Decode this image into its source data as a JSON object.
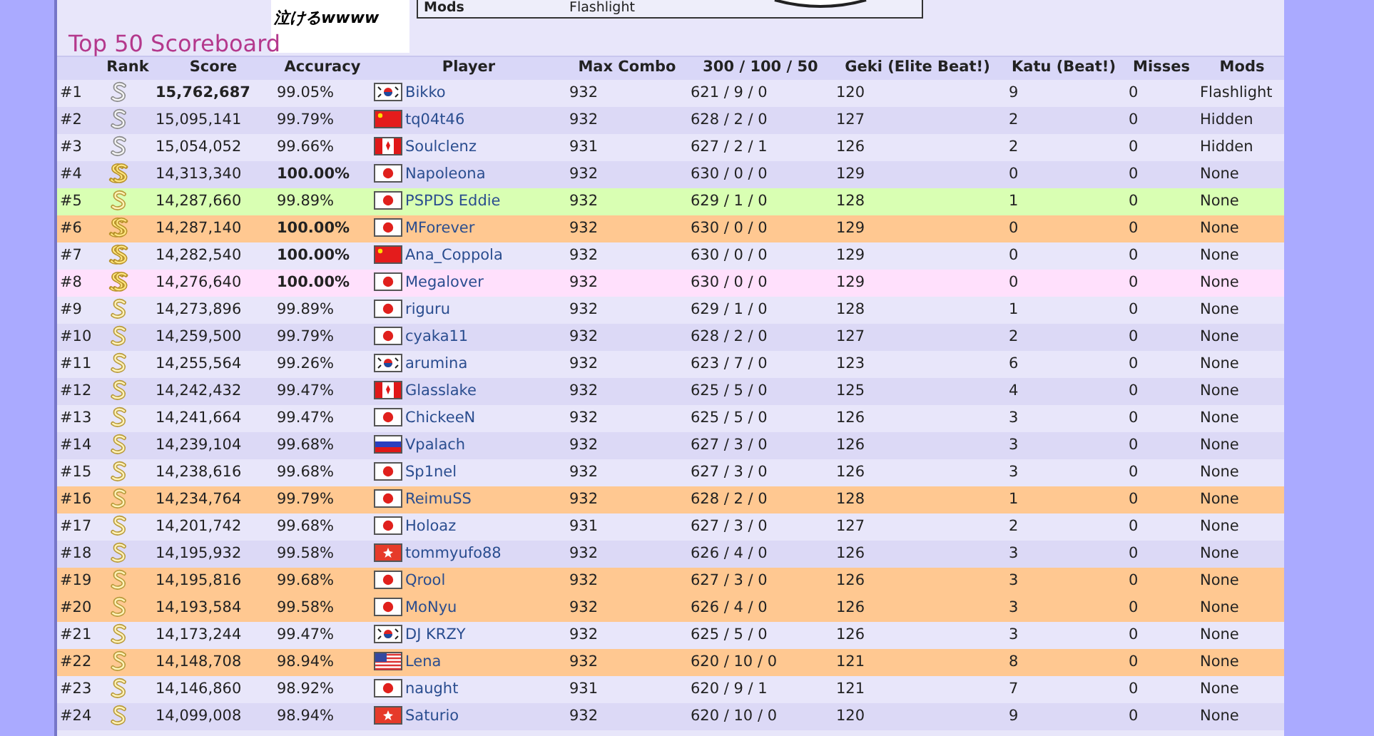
{
  "mods_box": {
    "label": "Mods",
    "value": "Flashlight"
  },
  "banner": {
    "text": "泣けるwwww"
  },
  "title": "Top 50 Scoreboard",
  "columns": [
    "Rank",
    "Score",
    "Accuracy",
    "Player",
    "Max Combo",
    "300 / 100 / 50",
    "Geki (Elite Beat!)",
    "Katu (Beat!)",
    "Misses",
    "Mods"
  ],
  "rows": [
    {
      "position": "#1",
      "grade": {
        "kind": "s_silver"
      },
      "score": "15,762,687",
      "score_bold": true,
      "accuracy": "99.05%",
      "accuracy_bold": false,
      "flag": {
        "kind": "kr"
      },
      "player": "Bikko",
      "max_combo": "932",
      "hits": "621 / 9 / 0",
      "geki": "120",
      "katu": "9",
      "misses": "0",
      "mods": "Flashlight"
    },
    {
      "position": "#2",
      "grade": {
        "kind": "s_silver"
      },
      "score": "15,095,141",
      "score_bold": false,
      "accuracy": "99.79%",
      "accuracy_bold": false,
      "flag": {
        "kind": "cn"
      },
      "player": "tq04t46",
      "max_combo": "932",
      "hits": "628 / 2 / 0",
      "geki": "127",
      "katu": "2",
      "misses": "0",
      "mods": "Hidden"
    },
    {
      "position": "#3",
      "grade": {
        "kind": "s_silver"
      },
      "score": "15,054,052",
      "score_bold": false,
      "accuracy": "99.66%",
      "accuracy_bold": false,
      "flag": {
        "kind": "ca"
      },
      "player": "Soulclenz",
      "max_combo": "931",
      "hits": "627 / 2 / 1",
      "geki": "126",
      "katu": "2",
      "misses": "0",
      "mods": "Hidden"
    },
    {
      "position": "#4",
      "grade": {
        "kind": "ss_gold"
      },
      "score": "14,313,340",
      "score_bold": false,
      "accuracy": "100.00%",
      "accuracy_bold": true,
      "flag": {
        "kind": "jp"
      },
      "player": "Napoleona",
      "max_combo": "932",
      "hits": "630 / 0 / 0",
      "geki": "129",
      "katu": "0",
      "misses": "0",
      "mods": "None"
    },
    {
      "position": "#5",
      "grade": {
        "kind": "s_gold"
      },
      "score": "14,287,660",
      "score_bold": false,
      "accuracy": "99.89%",
      "accuracy_bold": false,
      "flag": {
        "kind": "jp"
      },
      "player": "PSPDS Eddie",
      "max_combo": "932",
      "hits": "629 / 1 / 0",
      "geki": "128",
      "katu": "1",
      "misses": "0",
      "mods": "None",
      "color": "#d9ffb3"
    },
    {
      "position": "#6",
      "grade": {
        "kind": "ss_gold"
      },
      "score": "14,287,140",
      "score_bold": false,
      "accuracy": "100.00%",
      "accuracy_bold": true,
      "flag": {
        "kind": "jp"
      },
      "player": "MForever",
      "max_combo": "932",
      "hits": "630 / 0 / 0",
      "geki": "129",
      "katu": "0",
      "misses": "0",
      "mods": "None",
      "color": "#ffc891"
    },
    {
      "position": "#7",
      "grade": {
        "kind": "ss_gold"
      },
      "score": "14,282,540",
      "score_bold": false,
      "accuracy": "100.00%",
      "accuracy_bold": true,
      "flag": {
        "kind": "cn"
      },
      "player": "Ana_Coppola",
      "max_combo": "932",
      "hits": "630 / 0 / 0",
      "geki": "129",
      "katu": "0",
      "misses": "0",
      "mods": "None"
    },
    {
      "position": "#8",
      "grade": {
        "kind": "ss_gold"
      },
      "score": "14,276,640",
      "score_bold": false,
      "accuracy": "100.00%",
      "accuracy_bold": true,
      "flag": {
        "kind": "jp"
      },
      "player": "Megalover",
      "max_combo": "932",
      "hits": "630 / 0 / 0",
      "geki": "129",
      "katu": "0",
      "misses": "0",
      "mods": "None",
      "color": "#ffe0fc"
    },
    {
      "position": "#9",
      "grade": {
        "kind": "s_gold"
      },
      "score": "14,273,896",
      "score_bold": false,
      "accuracy": "99.89%",
      "accuracy_bold": false,
      "flag": {
        "kind": "jp"
      },
      "player": "riguru",
      "max_combo": "932",
      "hits": "629 / 1 / 0",
      "geki": "128",
      "katu": "1",
      "misses": "0",
      "mods": "None"
    },
    {
      "position": "#10",
      "grade": {
        "kind": "s_gold"
      },
      "score": "14,259,500",
      "score_bold": false,
      "accuracy": "99.79%",
      "accuracy_bold": false,
      "flag": {
        "kind": "jp"
      },
      "player": "cyaka11",
      "max_combo": "932",
      "hits": "628 / 2 / 0",
      "geki": "127",
      "katu": "2",
      "misses": "0",
      "mods": "None"
    },
    {
      "position": "#11",
      "grade": {
        "kind": "s_gold"
      },
      "score": "14,255,564",
      "score_bold": false,
      "accuracy": "99.26%",
      "accuracy_bold": false,
      "flag": {
        "kind": "kr"
      },
      "player": "arumina",
      "max_combo": "932",
      "hits": "623 / 7 / 0",
      "geki": "123",
      "katu": "6",
      "misses": "0",
      "mods": "None"
    },
    {
      "position": "#12",
      "grade": {
        "kind": "s_gold"
      },
      "score": "14,242,432",
      "score_bold": false,
      "accuracy": "99.47%",
      "accuracy_bold": false,
      "flag": {
        "kind": "ca"
      },
      "player": "Glasslake",
      "max_combo": "932",
      "hits": "625 / 5 / 0",
      "geki": "125",
      "katu": "4",
      "misses": "0",
      "mods": "None"
    },
    {
      "position": "#13",
      "grade": {
        "kind": "s_gold"
      },
      "score": "14,241,664",
      "score_bold": false,
      "accuracy": "99.47%",
      "accuracy_bold": false,
      "flag": {
        "kind": "jp"
      },
      "player": "ChickeeN",
      "max_combo": "932",
      "hits": "625 / 5 / 0",
      "geki": "126",
      "katu": "3",
      "misses": "0",
      "mods": "None"
    },
    {
      "position": "#14",
      "grade": {
        "kind": "s_gold"
      },
      "score": "14,239,104",
      "score_bold": false,
      "accuracy": "99.68%",
      "accuracy_bold": false,
      "flag": {
        "kind": "ru"
      },
      "player": "Vpalach",
      "max_combo": "932",
      "hits": "627 / 3 / 0",
      "geki": "126",
      "katu": "3",
      "misses": "0",
      "mods": "None"
    },
    {
      "position": "#15",
      "grade": {
        "kind": "s_gold"
      },
      "score": "14,238,616",
      "score_bold": false,
      "accuracy": "99.68%",
      "accuracy_bold": false,
      "flag": {
        "kind": "jp"
      },
      "player": "Sp1nel",
      "max_combo": "932",
      "hits": "627 / 3 / 0",
      "geki": "126",
      "katu": "3",
      "misses": "0",
      "mods": "None"
    },
    {
      "position": "#16",
      "grade": {
        "kind": "s_gold"
      },
      "score": "14,234,764",
      "score_bold": false,
      "accuracy": "99.79%",
      "accuracy_bold": false,
      "flag": {
        "kind": "jp"
      },
      "player": "ReimuSS",
      "max_combo": "932",
      "hits": "628 / 2 / 0",
      "geki": "128",
      "katu": "1",
      "misses": "0",
      "mods": "None",
      "color": "#ffc891"
    },
    {
      "position": "#17",
      "grade": {
        "kind": "s_gold"
      },
      "score": "14,201,742",
      "score_bold": false,
      "accuracy": "99.68%",
      "accuracy_bold": false,
      "flag": {
        "kind": "jp"
      },
      "player": "Holoaz",
      "max_combo": "931",
      "hits": "627 / 3 / 0",
      "geki": "127",
      "katu": "2",
      "misses": "0",
      "mods": "None"
    },
    {
      "position": "#18",
      "grade": {
        "kind": "s_gold"
      },
      "score": "14,195,932",
      "score_bold": false,
      "accuracy": "99.58%",
      "accuracy_bold": false,
      "flag": {
        "kind": "hk"
      },
      "player": "tommyufo88",
      "max_combo": "932",
      "hits": "626 / 4 / 0",
      "geki": "126",
      "katu": "3",
      "misses": "0",
      "mods": "None"
    },
    {
      "position": "#19",
      "grade": {
        "kind": "s_gold"
      },
      "score": "14,195,816",
      "score_bold": false,
      "accuracy": "99.68%",
      "accuracy_bold": false,
      "flag": {
        "kind": "jp"
      },
      "player": "Qrool",
      "max_combo": "932",
      "hits": "627 / 3 / 0",
      "geki": "126",
      "katu": "3",
      "misses": "0",
      "mods": "None",
      "color": "#ffc891"
    },
    {
      "position": "#20",
      "grade": {
        "kind": "s_gold"
      },
      "score": "14,193,584",
      "score_bold": false,
      "accuracy": "99.58%",
      "accuracy_bold": false,
      "flag": {
        "kind": "jp"
      },
      "player": "MoNyu",
      "max_combo": "932",
      "hits": "626 / 4 / 0",
      "geki": "126",
      "katu": "3",
      "misses": "0",
      "mods": "None",
      "color": "#ffc891"
    },
    {
      "position": "#21",
      "grade": {
        "kind": "s_gold"
      },
      "score": "14,173,244",
      "score_bold": false,
      "accuracy": "99.47%",
      "accuracy_bold": false,
      "flag": {
        "kind": "kr"
      },
      "player": "DJ KRZY",
      "max_combo": "932",
      "hits": "625 / 5 / 0",
      "geki": "126",
      "katu": "3",
      "misses": "0",
      "mods": "None"
    },
    {
      "position": "#22",
      "grade": {
        "kind": "s_gold"
      },
      "score": "14,148,708",
      "score_bold": false,
      "accuracy": "98.94%",
      "accuracy_bold": false,
      "flag": {
        "kind": "us"
      },
      "player": "Lena",
      "max_combo": "932",
      "hits": "620 / 10 / 0",
      "geki": "121",
      "katu": "8",
      "misses": "0",
      "mods": "None",
      "color": "#ffc891"
    },
    {
      "position": "#23",
      "grade": {
        "kind": "s_gold"
      },
      "score": "14,146,860",
      "score_bold": false,
      "accuracy": "98.92%",
      "accuracy_bold": false,
      "flag": {
        "kind": "jp"
      },
      "player": "naught",
      "max_combo": "931",
      "hits": "620 / 9 / 1",
      "geki": "121",
      "katu": "7",
      "misses": "0",
      "mods": "None"
    },
    {
      "position": "#24",
      "grade": {
        "kind": "s_gold"
      },
      "score": "14,099,008",
      "score_bold": false,
      "accuracy": "98.94%",
      "accuracy_bold": false,
      "flag": {
        "kind": "hk"
      },
      "player": "Saturio",
      "max_combo": "932",
      "hits": "620 / 10 / 0",
      "geki": "120",
      "katu": "9",
      "misses": "0",
      "mods": "None"
    }
  ]
}
